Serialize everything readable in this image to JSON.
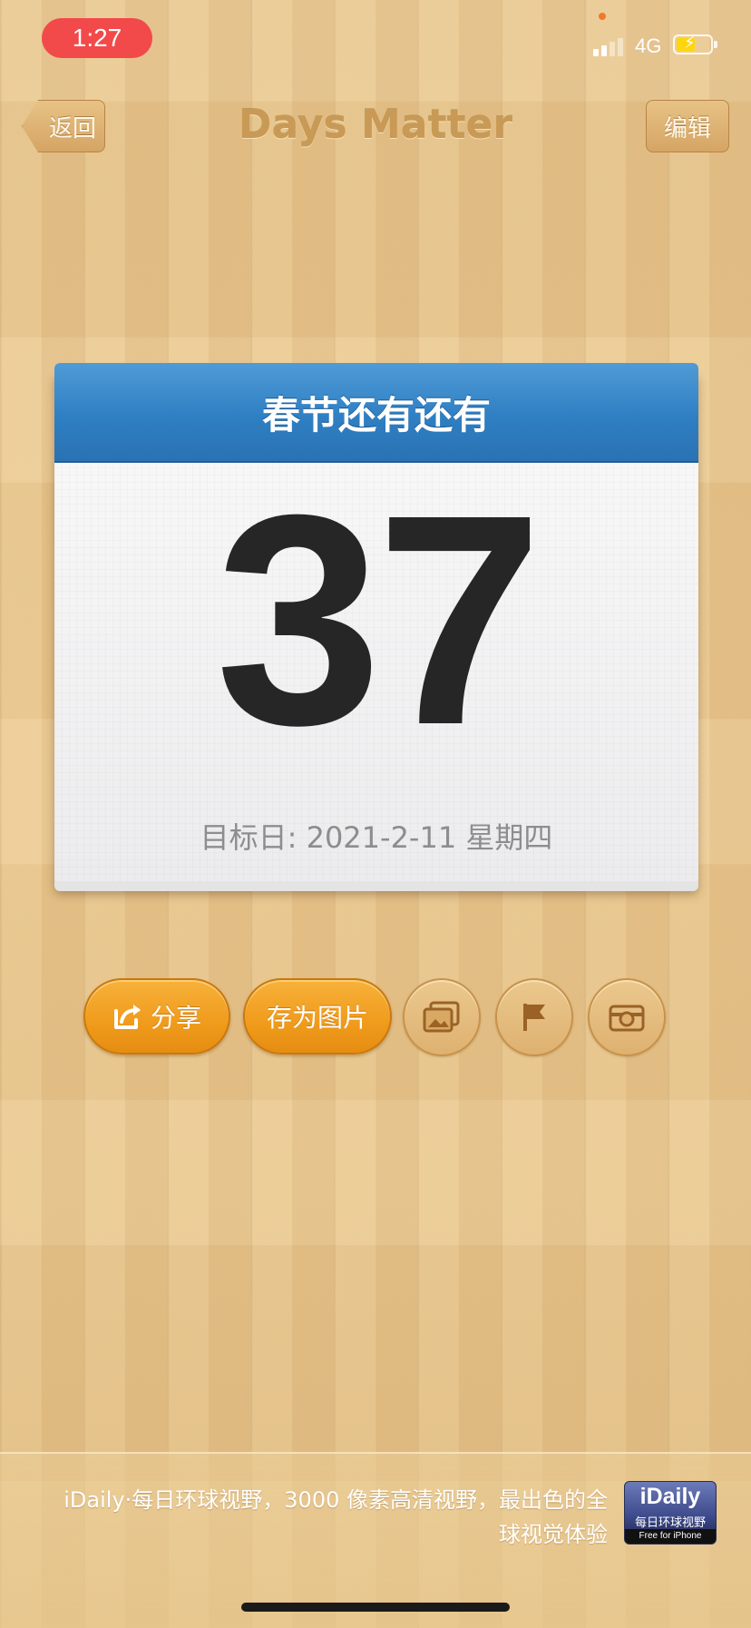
{
  "status_bar": {
    "time": "1:27",
    "network": "4G"
  },
  "nav": {
    "back_label": "返回",
    "title": "Days Matter",
    "edit_label": "编辑"
  },
  "card": {
    "title": "春节还有还有",
    "days": "37",
    "target_date": "目标日: 2021-2-11 星期四"
  },
  "actions": {
    "share_label": "分享",
    "save_image_label": "存为图片",
    "icons": [
      "gallery-icon",
      "flag-icon",
      "camera-icon"
    ]
  },
  "ad": {
    "text": "iDaily·每日环球视野，3000 像素高清视野，最出色的全球视觉体验",
    "logo_name": "iDaily",
    "logo_sub": "每日环球视野",
    "logo_free": "Free for iPhone"
  },
  "colors": {
    "card_header": "#2f7fc3",
    "action_orange": "#f09b1c",
    "time_pill": "#f2494b"
  }
}
